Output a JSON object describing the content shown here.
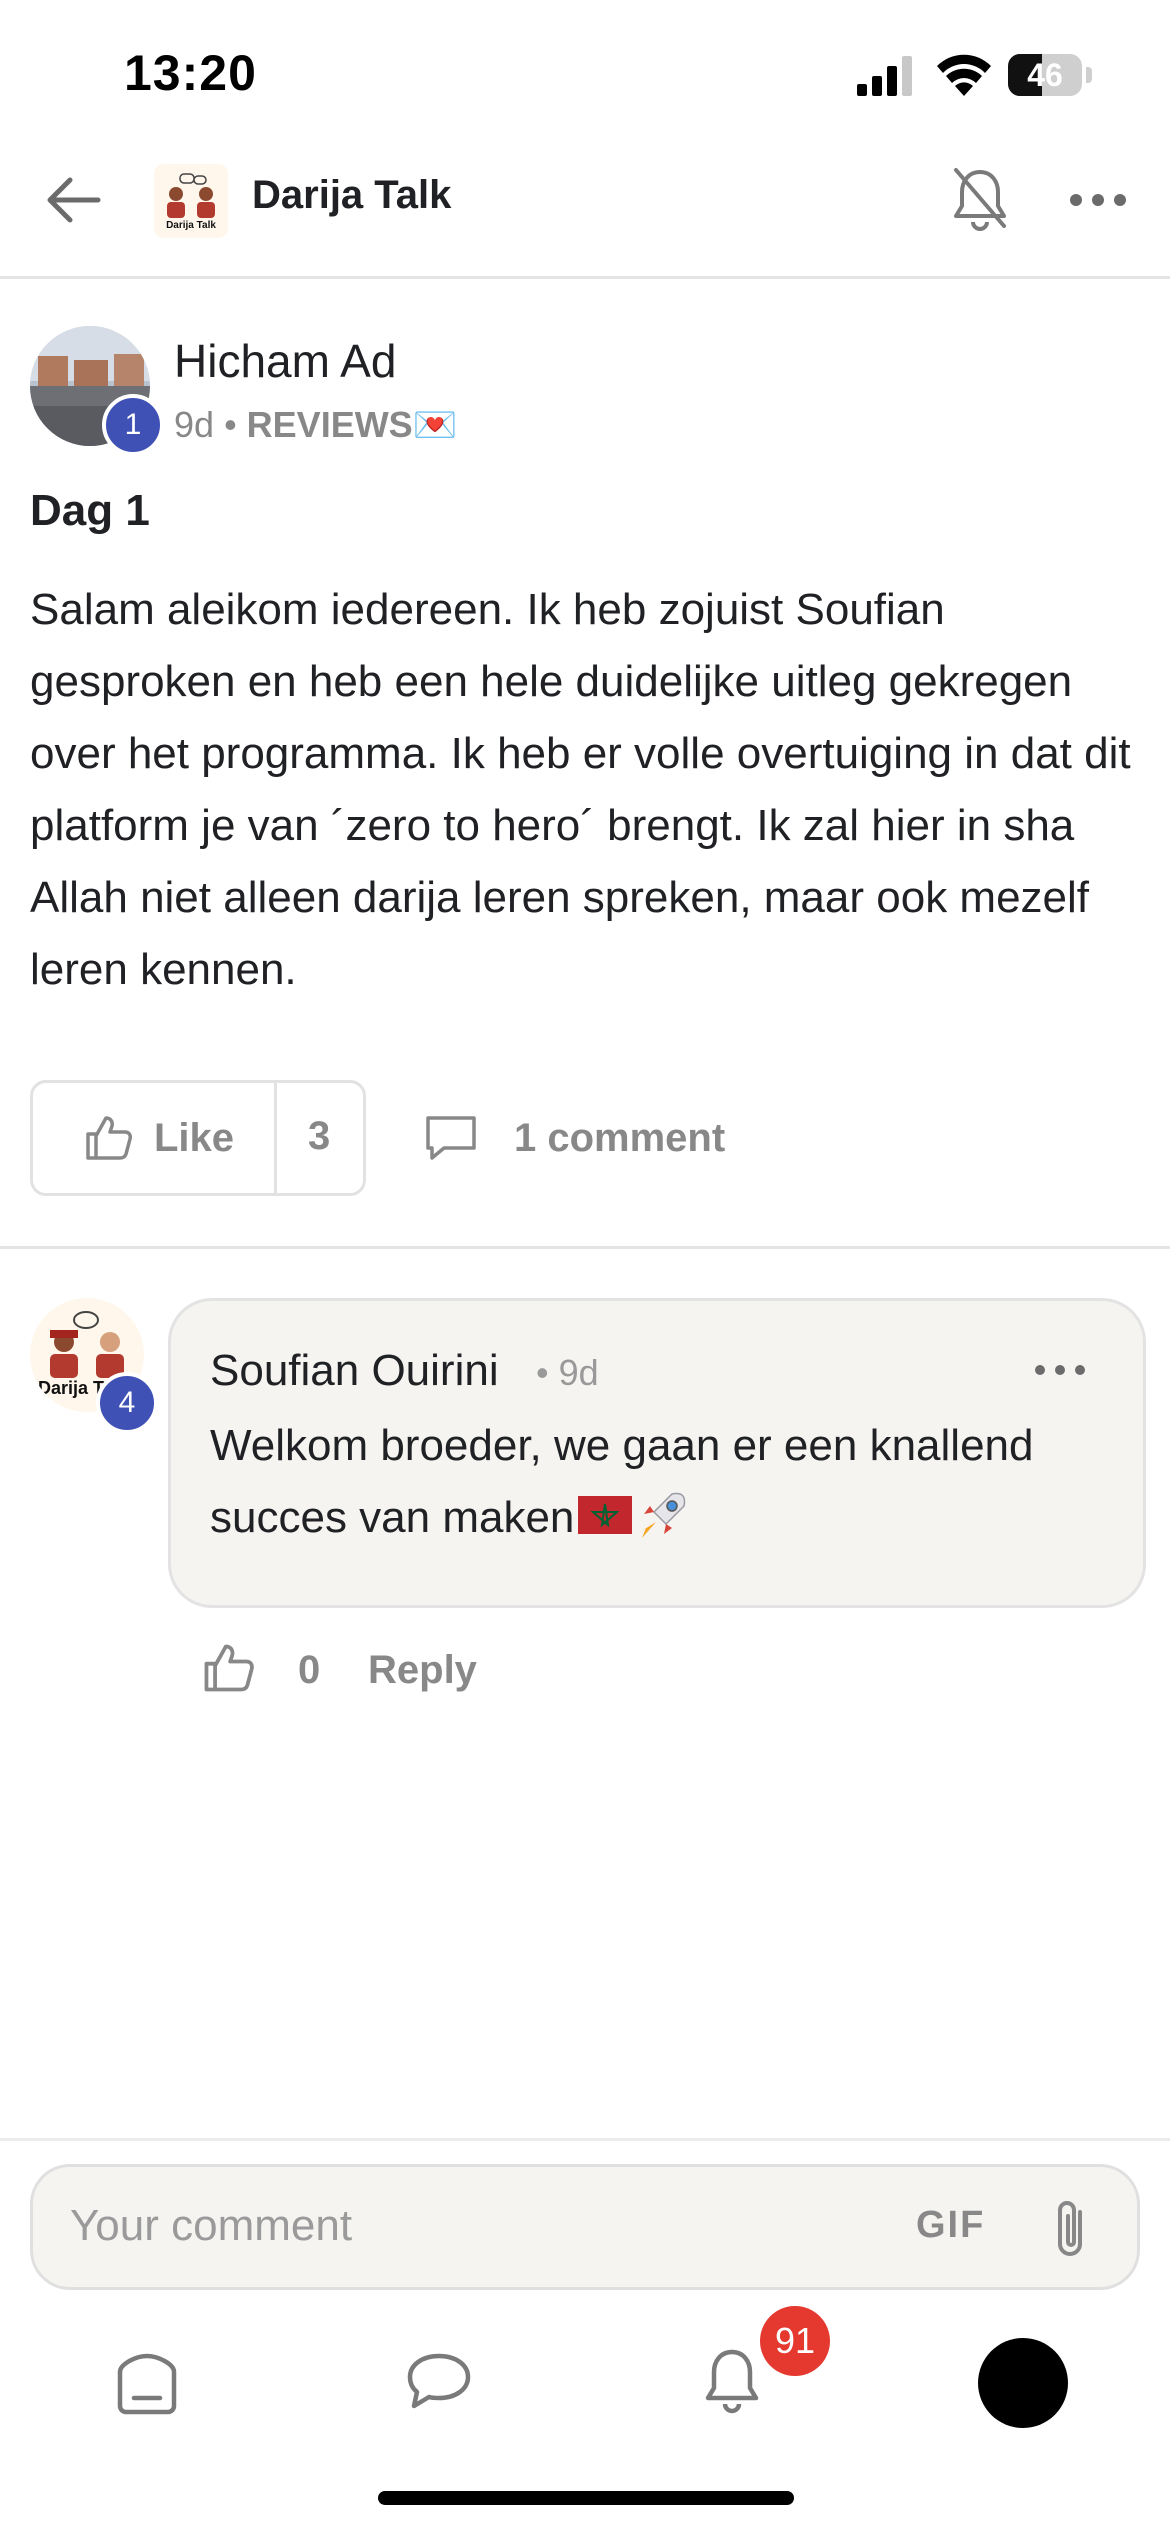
{
  "status_bar": {
    "time": "13:20",
    "battery": "46",
    "battery_level": 0.46
  },
  "header": {
    "group_name": "Darija Talk",
    "logo_text": "Darija Talk"
  },
  "post": {
    "author": "Hicham Ad",
    "level": "1",
    "time": "9d",
    "category": "REVIEWS💌",
    "title": "Dag 1",
    "body": "Salam aleikom iedereen. Ik heb zojuist Soufian gesproken en heb een hele duidelijke uitleg gekregen over het programma. Ik heb er volle overtuiging in dat dit platform je van ´zero to hero´ brengt. Ik zal hier in sha Allah niet alleen darija leren spreken, maar ook mezelf leren kennen.",
    "like_label": "Like",
    "like_count": "3",
    "comment_count_label": "1 comment"
  },
  "comment": {
    "author": "Soufian Ouirini",
    "level": "4",
    "time": "9d",
    "text": "Welkom broeder, we gaan er een knallend succes van maken",
    "like_count": "0",
    "reply_label": "Reply"
  },
  "composer": {
    "placeholder": "Your comment",
    "gif_label": "GIF"
  },
  "tab_bar": {
    "notifications_badge": "91"
  },
  "colors": {
    "level_badge": "#3f51b5",
    "notif_badge": "#e5392f",
    "muted_text": "#888888"
  }
}
